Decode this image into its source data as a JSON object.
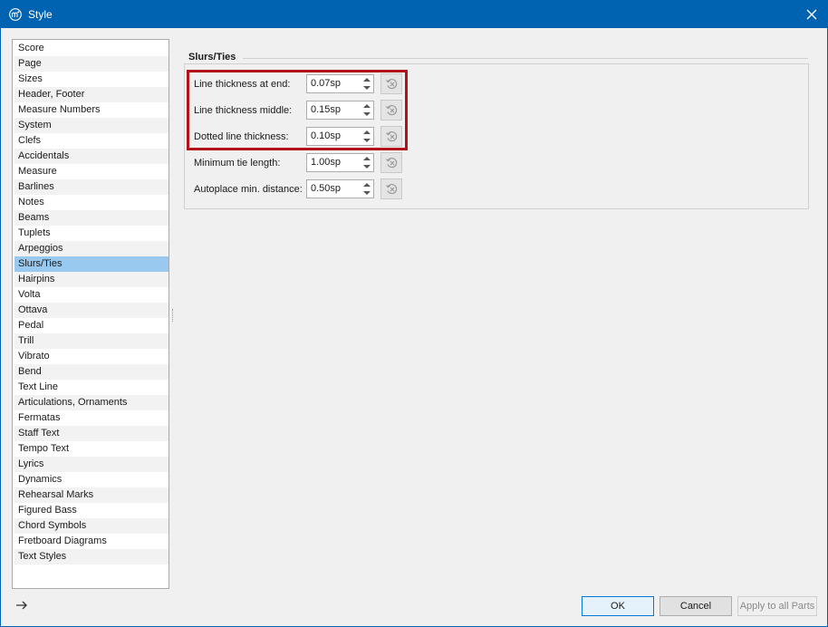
{
  "window": {
    "title": "Style"
  },
  "sidebar": {
    "items": [
      {
        "label": "Score"
      },
      {
        "label": "Page"
      },
      {
        "label": "Sizes"
      },
      {
        "label": "Header, Footer"
      },
      {
        "label": "Measure Numbers"
      },
      {
        "label": "System"
      },
      {
        "label": "Clefs"
      },
      {
        "label": "Accidentals"
      },
      {
        "label": "Measure"
      },
      {
        "label": "Barlines"
      },
      {
        "label": "Notes"
      },
      {
        "label": "Beams"
      },
      {
        "label": "Tuplets"
      },
      {
        "label": "Arpeggios"
      },
      {
        "label": "Slurs/Ties"
      },
      {
        "label": "Hairpins"
      },
      {
        "label": "Volta"
      },
      {
        "label": "Ottava"
      },
      {
        "label": "Pedal"
      },
      {
        "label": "Trill"
      },
      {
        "label": "Vibrato"
      },
      {
        "label": "Bend"
      },
      {
        "label": "Text Line"
      },
      {
        "label": "Articulations, Ornaments"
      },
      {
        "label": "Fermatas"
      },
      {
        "label": "Staff Text"
      },
      {
        "label": "Tempo Text"
      },
      {
        "label": "Lyrics"
      },
      {
        "label": "Dynamics"
      },
      {
        "label": "Rehearsal Marks"
      },
      {
        "label": "Figured Bass"
      },
      {
        "label": "Chord Symbols"
      },
      {
        "label": "Fretboard Diagrams"
      },
      {
        "label": "Text Styles"
      }
    ],
    "selected": "Slurs/Ties"
  },
  "section": {
    "title": "Slurs/Ties",
    "rows": [
      {
        "label": "Line thickness at end:",
        "value": "0.07sp"
      },
      {
        "label": "Line thickness middle:",
        "value": "0.15sp"
      },
      {
        "label": "Dotted line thickness:",
        "value": "0.10sp"
      },
      {
        "label": "Minimum tie length:",
        "value": "1.00sp"
      },
      {
        "label": "Autoplace min. distance:",
        "value": "0.50sp"
      }
    ]
  },
  "buttons": {
    "ok": "OK",
    "cancel": "Cancel",
    "apply": "Apply to all Parts"
  },
  "colors": {
    "titlebar": "#0063b1",
    "selection": "#99c9ef",
    "highlight": "#b2131b"
  }
}
